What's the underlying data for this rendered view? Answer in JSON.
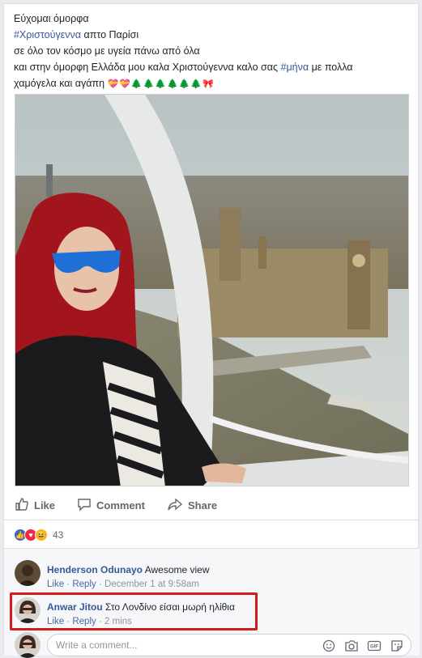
{
  "post": {
    "caption_line1": "Εύχομαι όμορφα",
    "caption_tag1": "#Χριστούγεννα",
    "caption_line2_rest": " απτο Παρίσι",
    "caption_line3": "σε όλο τον κόσμο με υγεία πάνω από όλα",
    "caption_line4_pre": "και στην όμορφη Ελλάδα μου καλα Χριστούγεννα καλο σας ",
    "caption_tag2": "#μήνα",
    "caption_line4_post": " με πολλα",
    "caption_line5": "χαμόγελα και αγάπη",
    "emoji_string": "💝💝🌲🌲🌲🌲🌲🌲🎀"
  },
  "actions": {
    "like": "Like",
    "comment": "Comment",
    "share": "Share"
  },
  "reactions": {
    "count": "43",
    "colors": {
      "like": "#4267b2",
      "love": "#f0284a",
      "haha": "#f7b125"
    }
  },
  "comments": [
    {
      "name": "Henderson Odunayo",
      "text": "Awesome view",
      "like": "Like",
      "reply": "Reply",
      "time": "December 1 at 9:58am"
    },
    {
      "name": "Anwar Jitou",
      "text": "Στο Λονδίνο είσαι μωρή ηλίθια",
      "like": "Like",
      "reply": "Reply",
      "time": "2 mins"
    }
  ],
  "composer": {
    "placeholder": "Write a comment..."
  },
  "colors": {
    "link": "#365899",
    "highlight": "#d21c1c"
  }
}
